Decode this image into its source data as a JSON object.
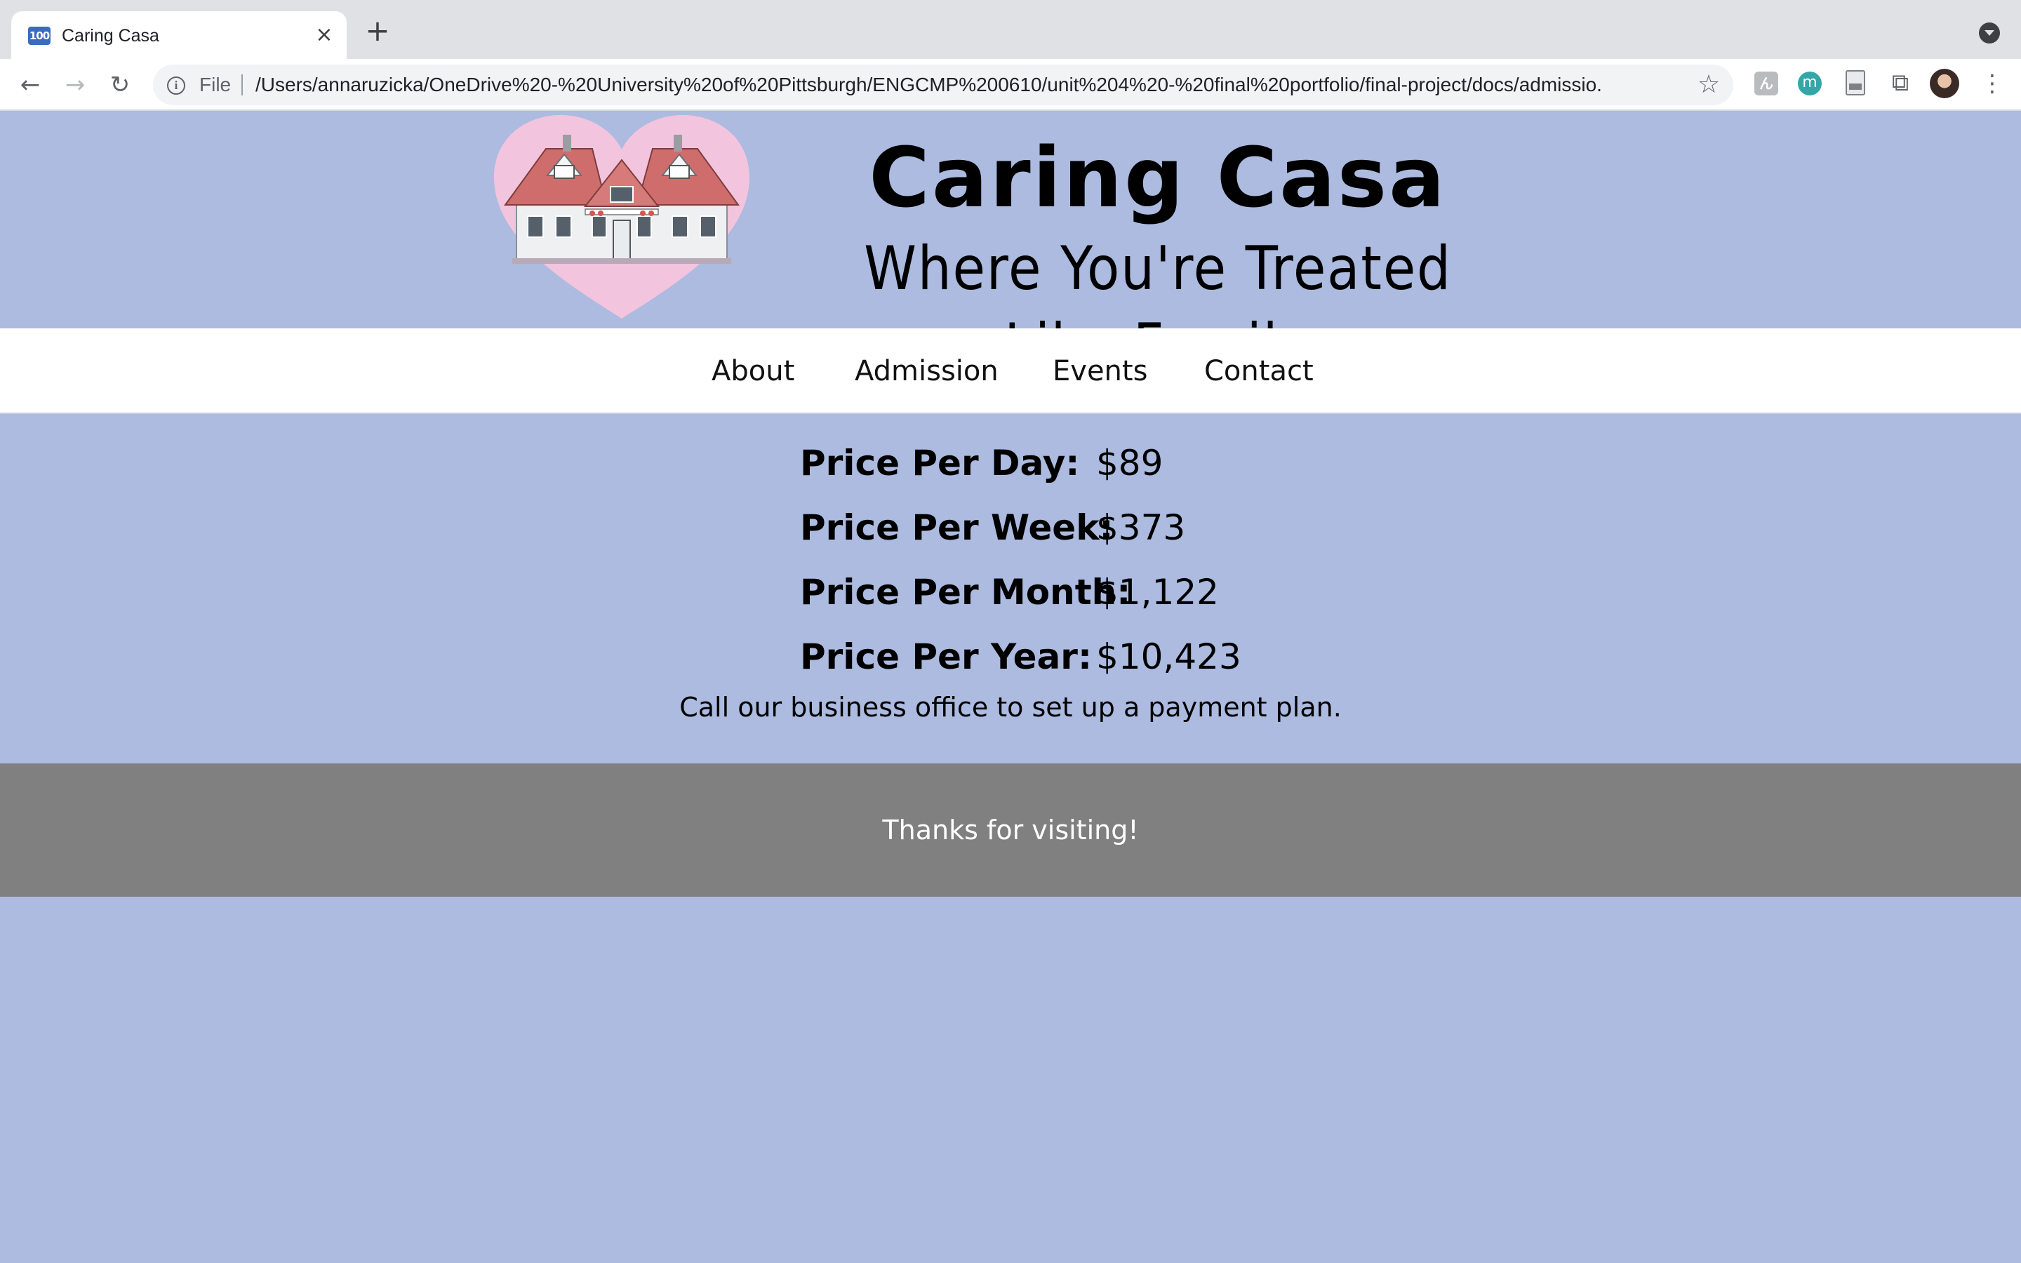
{
  "browser": {
    "tab": {
      "favicon_text": "100",
      "title": "Caring Casa",
      "close_glyph": "×"
    },
    "new_tab_glyph": "+",
    "address_bar": {
      "scheme_label": "File",
      "url": "/Users/annaruzicka/OneDrive%20-%20University%20of%20Pittsburgh/ENGCMP%200610/unit%204%20-%20final%20portfolio/final-project/docs/admissio..."
    },
    "icons": {
      "back": "back-arrow-icon",
      "forward": "forward-arrow-icon",
      "reload": "reload-icon",
      "info": "info-icon",
      "bookmark": "star-icon",
      "extensions": "puzzle-icon",
      "menu": "kebab-menu-icon"
    },
    "extensions": {
      "ext1_glyph": "ん",
      "ext2_glyph": "m"
    }
  },
  "site": {
    "title": "Caring Casa",
    "tagline": "Where You're Treated Like Family",
    "logo": "house-in-pink-heart",
    "colors": {
      "background": "#acbbdf",
      "nav_background": "#ffffff",
      "footer_background": "#808080",
      "logo_heart": "#f2c4de"
    }
  },
  "nav": {
    "items": [
      {
        "label": "About"
      },
      {
        "label": "Admission"
      },
      {
        "label": "Events"
      },
      {
        "label": "Contact"
      }
    ]
  },
  "prices": [
    {
      "label": "Price Per Day:",
      "value": "$89"
    },
    {
      "label": "Price Per Week:",
      "value": "$373"
    },
    {
      "label": "Price Per Month:",
      "value": "$1,122"
    },
    {
      "label": "Price Per Year:",
      "value": "$10,423"
    }
  ],
  "payment_note": "Call our business office to set up a payment plan.",
  "footer": {
    "text": "Thanks for visiting!"
  }
}
